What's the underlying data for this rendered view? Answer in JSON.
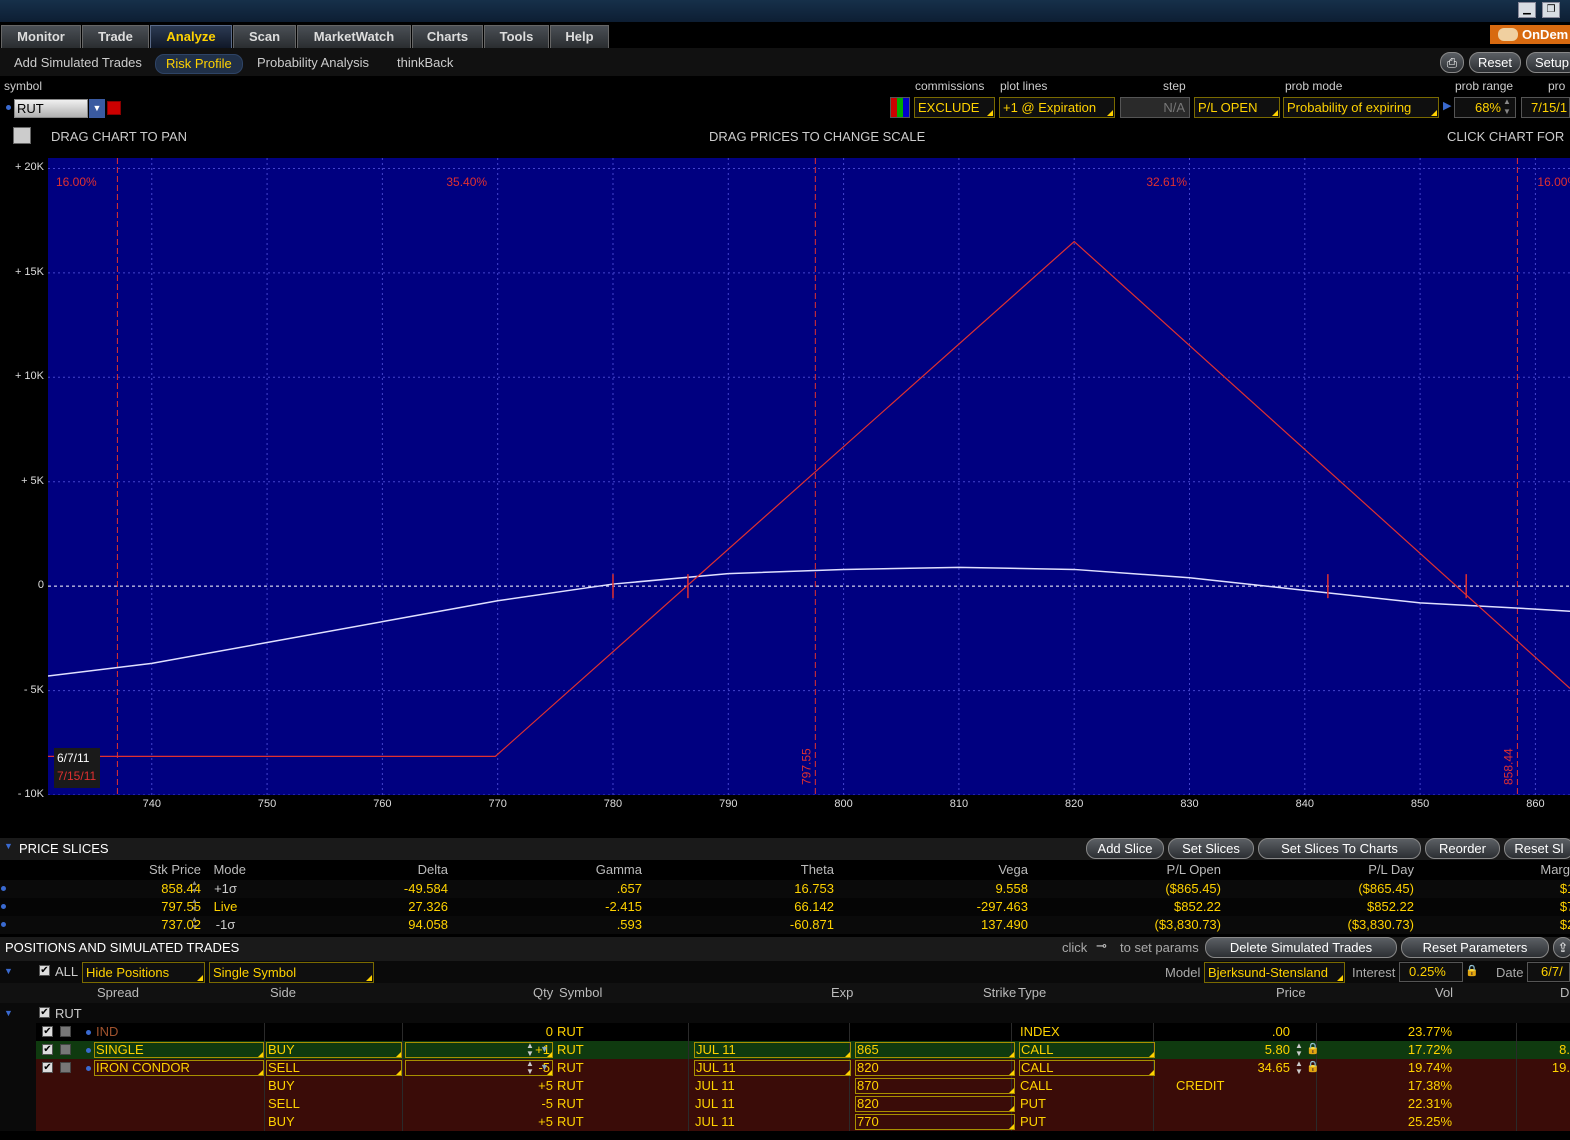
{
  "window": {
    "minimize": "▁",
    "restore": "❐"
  },
  "nav": {
    "tabs": [
      "Monitor",
      "Trade",
      "Analyze",
      "Scan",
      "MarketWatch",
      "Charts",
      "Tools",
      "Help"
    ],
    "active": "Analyze",
    "ondemand": "OnDem"
  },
  "subnav": {
    "tabs": [
      "Add Simulated Trades",
      "Risk Profile",
      "Probability Analysis",
      "thinkBack"
    ],
    "active": "Risk Profile",
    "reset": "Reset",
    "setup": "Setup"
  },
  "controls": {
    "symbol_label": "symbol",
    "symbol": "RUT",
    "commissions_label": "commissions",
    "commissions": "EXCLUDE",
    "plotlines_label": "plot lines",
    "plotlines": "+1 @ Expiration",
    "step_label": "step",
    "step": "N/A",
    "pl_mode": "P/L OPEN",
    "probmode_label": "prob mode",
    "probmode": "Probability of expiring",
    "probrange_label": "prob range",
    "probrange": "68%",
    "date_label": "pro",
    "date": "7/15/1"
  },
  "chart_hints": {
    "pan": "DRAG CHART TO PAN",
    "scale": "DRAG PRICES TO CHANGE SCALE",
    "click": "CLICK CHART FOR"
  },
  "chart_data": {
    "type": "line",
    "xlim": [
      731,
      863
    ],
    "ylim": [
      -10000,
      20500
    ],
    "x_ticks": [
      740,
      750,
      760,
      770,
      780,
      790,
      800,
      810,
      820,
      830,
      840,
      850,
      860
    ],
    "y_ticks": [
      {
        "v": 20000,
        "l": "+ 20K"
      },
      {
        "v": 15000,
        "l": "+ 15K"
      },
      {
        "v": 10000,
        "l": "+ 10K"
      },
      {
        "v": 5000,
        "l": "+ 5K"
      },
      {
        "v": 0,
        "l": "0"
      },
      {
        "v": -5000,
        "l": "- 5K"
      },
      {
        "v": -10000,
        "l": "- 10K"
      }
    ],
    "series": [
      {
        "name": "6/7/11",
        "color": "#e0e0ff",
        "x": [
          731,
          740,
          750,
          760,
          770,
          780,
          790,
          800,
          810,
          820,
          830,
          840,
          850,
          860,
          863
        ],
        "y": [
          -4300,
          -3700,
          -2700,
          -1700,
          -700,
          100,
          600,
          800,
          900,
          800,
          400,
          -200,
          -800,
          -1100,
          -1200
        ]
      },
      {
        "name": "7/15/11",
        "color": "#e03030",
        "x": [
          731,
          769.8,
          820,
          863
        ],
        "y": [
          -8150,
          -8150,
          16500,
          -4900
        ]
      }
    ],
    "zones": [
      {
        "x": [
          731,
          737.02
        ],
        "pct": "16.00%"
      },
      {
        "x": [
          737.02,
          797.55
        ],
        "pct": "35.40%"
      },
      {
        "x": [
          797.55,
          858.44
        ],
        "pct": "32.61%"
      },
      {
        "x": [
          858.44,
          863
        ],
        "pct": "16.00%"
      }
    ],
    "vlines": [
      {
        "x": 737.02,
        "label": ""
      },
      {
        "x": 797.55,
        "label": "797.55"
      },
      {
        "x": 858.44,
        "label": "858.44"
      }
    ],
    "breakevens_expiry": [
      786.5,
      854
    ],
    "breakevens_today": [
      780,
      842
    ],
    "legend": [
      "6/7/11",
      "7/15/11"
    ]
  },
  "price_slices": {
    "title": "PRICE SLICES",
    "buttons": [
      "Add Slice",
      "Set Slices",
      "Set Slices To Charts",
      "Reorder",
      "Reset Sl"
    ],
    "headers": [
      "Stk Price",
      "Mode",
      "Delta",
      "Gamma",
      "Theta",
      "Vega",
      "P/L Open",
      "P/L Day",
      "Marg"
    ],
    "rows": [
      [
        "858.44",
        "+1σ",
        "-49.584",
        ".657",
        "16.753",
        "9.558",
        "($865.45)",
        "($865.45)",
        "$1,"
      ],
      [
        "797.55",
        "Live",
        "27.326",
        "-2.415",
        "66.142",
        "-297.463",
        "$852.22",
        "$852.22",
        "$7,"
      ],
      [
        "737.02",
        "-1σ",
        "94.058",
        ".593",
        "-60.871",
        "137.490",
        "($3,830.73)",
        "($3,830.73)",
        "$2,"
      ]
    ]
  },
  "positions": {
    "title": "POSITIONS AND SIMULATED TRADES",
    "click_hint": "click",
    "set_params": "to set params",
    "delete_btn": "Delete Simulated Trades",
    "reset_btn": "Reset Parameters",
    "all_label": "ALL",
    "hide": "Hide Positions",
    "single": "Single Symbol",
    "model_label": "Model",
    "model": "Bjerksund-Stensland",
    "interest_label": "Interest",
    "interest": "0.25%",
    "date_label": "Date",
    "date": "6/7/",
    "headers": {
      "spread": "Spread",
      "side": "Side",
      "qty": "Qty",
      "symbol": "Symbol",
      "exp": "Exp",
      "strike": "Strike",
      "type": "Type",
      "price": "Price",
      "vol": "Vol",
      "d": "D"
    },
    "group": "RUT",
    "rows": [
      {
        "spread": "IND",
        "side": "",
        "qty": "0",
        "symbol": "RUT",
        "exp": "",
        "strike": "",
        "type": "INDEX",
        "price": ".00",
        "vol": "23.77%",
        "extra": "",
        "bg": "#000"
      },
      {
        "spread": "SINGLE",
        "side": "BUY",
        "qty": "+1",
        "symbol": "RUT",
        "exp": "JUL 11",
        "strike": "865",
        "type": "CALL",
        "price": "5.80",
        "vol": "17.72%",
        "extra": "8.",
        "bg": "#0f3a0f"
      },
      {
        "spread": "IRON CONDOR",
        "side": "SELL",
        "qty": "-5",
        "symbol": "RUT",
        "exp": "JUL 11",
        "strike": "820",
        "type": "CALL",
        "price": "34.65",
        "vol": "19.74%",
        "extra": "19.",
        "bg": "#3a0c08"
      },
      {
        "spread": "",
        "side": "BUY",
        "qty": "+5",
        "symbol": "RUT",
        "exp": "JUL 11",
        "strike": "870",
        "type": "CALL",
        "price": "CREDIT",
        "vol": "17.38%",
        "extra": "",
        "bg": "#3a0c08"
      },
      {
        "spread": "",
        "side": "SELL",
        "qty": "-5",
        "symbol": "RUT",
        "exp": "JUL 11",
        "strike": "820",
        "type": "PUT",
        "price": "",
        "vol": "22.31%",
        "extra": "",
        "bg": "#3a0c08"
      },
      {
        "spread": "",
        "side": "BUY",
        "qty": "+5",
        "symbol": "RUT",
        "exp": "JUL 11",
        "strike": "770",
        "type": "PUT",
        "price": "",
        "vol": "25.25%",
        "extra": "",
        "bg": "#3a0c08"
      }
    ]
  }
}
